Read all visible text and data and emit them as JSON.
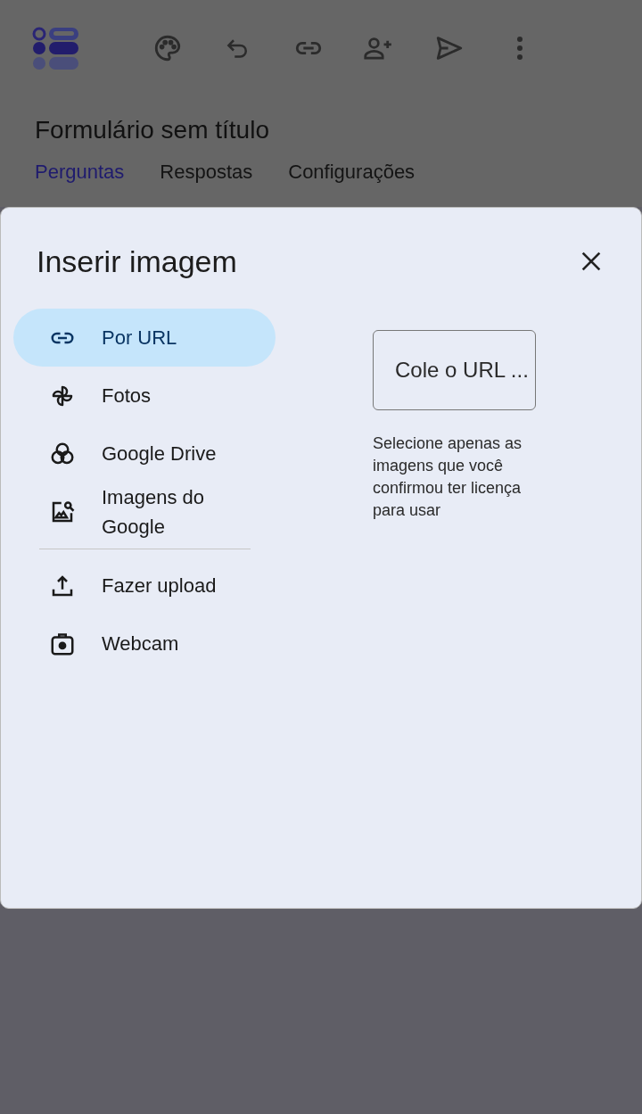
{
  "form": {
    "title": "Formulário sem título"
  },
  "tabs": [
    {
      "label": "Perguntas",
      "selected": true
    },
    {
      "label": "Respostas",
      "selected": false
    },
    {
      "label": "Configurações",
      "selected": false
    }
  ],
  "dialog": {
    "title": "Inserir imagem",
    "menu_groups": [
      [
        {
          "kind": "url",
          "label": "Por URL",
          "selected": true
        },
        {
          "kind": "photos",
          "label": "Fotos",
          "selected": false
        },
        {
          "kind": "drive",
          "label": "Google Drive",
          "selected": false
        },
        {
          "kind": "images",
          "label": "Imagens do Google",
          "selected": false
        }
      ],
      [
        {
          "kind": "upload",
          "label": "Fazer upload",
          "selected": false
        },
        {
          "kind": "webcam",
          "label": "Webcam",
          "selected": false
        }
      ]
    ],
    "url_field": {
      "placeholder": "Cole o URL ..."
    },
    "note": "Selecione apenas as imagens que você confirmou ter licença para usar"
  }
}
